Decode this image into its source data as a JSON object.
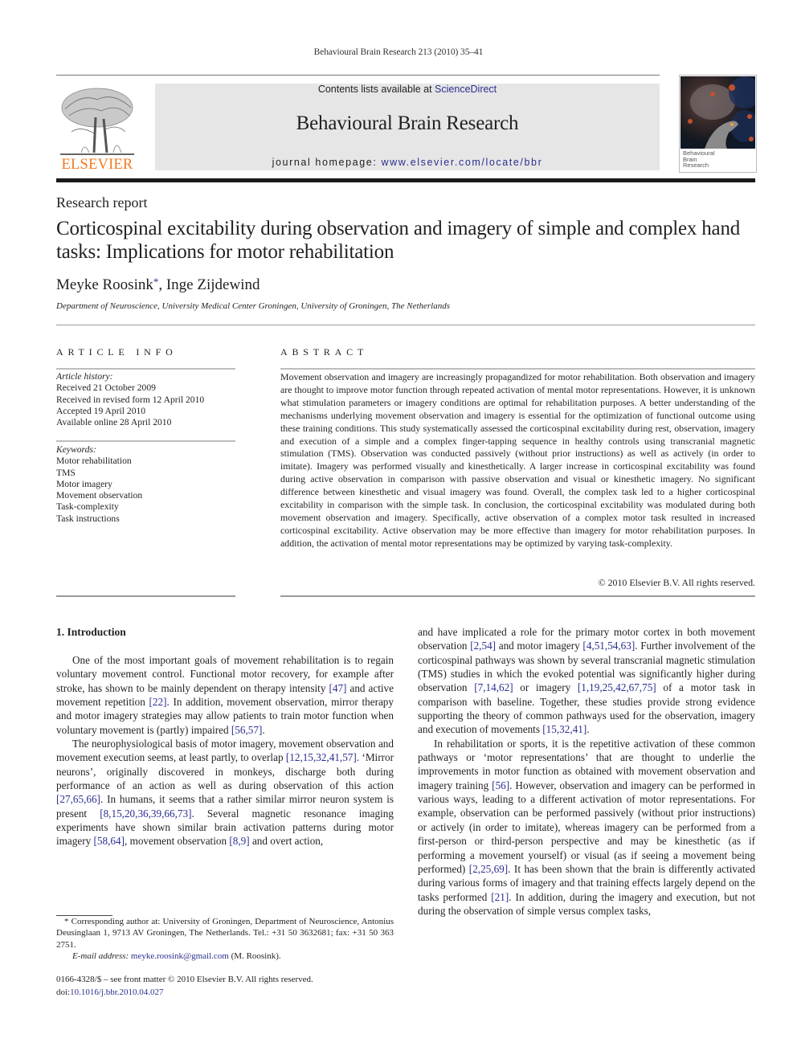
{
  "running_head": "Behavioural Brain Research 213 (2010) 35–41",
  "publisher": {
    "name": "ELSEVIER",
    "brand_color": "#f47920"
  },
  "journal_box": {
    "contents_prefix": "Contents lists available at ",
    "contents_link": "ScienceDirect",
    "journal_title": "Behavioural Brain Research",
    "homepage_prefix": "journal homepage: ",
    "homepage_link": "www.elsevier.com/locate/bbr",
    "link_color": "#2b2f8f"
  },
  "cover": {
    "title_lines": [
      "Behavioural",
      "Brain",
      "Research"
    ]
  },
  "article": {
    "type": "Research report",
    "title": "Corticospinal excitability during observation and imagery of simple and complex hand tasks: Implications for motor rehabilitation",
    "authors": [
      {
        "name": "Meyke Roosink",
        "mark": "*"
      },
      {
        "name": "Inge Zijdewind",
        "mark": ""
      }
    ],
    "author_separator": ", ",
    "affiliation": "Department of Neuroscience, University Medical Center Groningen, University of Groningen, The Netherlands"
  },
  "article_info": {
    "heading": "ARTICLE INFO",
    "history_label": "Article history:",
    "history": [
      "Received 21 October 2009",
      "Received in revised form 12 April 2010",
      "Accepted 19 April 2010",
      "Available online 28 April 2010"
    ],
    "keywords_label": "Keywords:",
    "keywords": [
      "Motor rehabilitation",
      "TMS",
      "Motor imagery",
      "Movement observation",
      "Task-complexity",
      "Task instructions"
    ]
  },
  "abstract": {
    "heading": "ABSTRACT",
    "text": "Movement observation and imagery are increasingly propagandized for motor rehabilitation. Both observation and imagery are thought to improve motor function through repeated activation of mental motor representations. However, it is unknown what stimulation parameters or imagery conditions are optimal for rehabilitation purposes. A better understanding of the mechanisms underlying movement observation and imagery is essential for the optimization of functional outcome using these training conditions. This study systematically assessed the corticospinal excitability during rest, observation, imagery and execution of a simple and a complex finger-tapping sequence in healthy controls using transcranial magnetic stimulation (TMS). Observation was conducted passively (without prior instructions) as well as actively (in order to imitate). Imagery was performed visually and kinesthetically. A larger increase in corticospinal excitability was found during active observation in comparison with passive observation and visual or kinesthetic imagery. No significant difference between kinesthetic and visual imagery was found. Overall, the complex task led to a higher corticospinal excitability in comparison with the simple task. In conclusion, the corticospinal excitability was modulated during both movement observation and imagery. Specifically, active observation of a complex motor task resulted in increased corticospinal excitability. Active observation may be more effective than imagery for motor rehabilitation purposes. In addition, the activation of mental motor representations may be optimized by varying task-complexity.",
    "copyright": "© 2010 Elsevier B.V. All rights reserved."
  },
  "body": {
    "section_heading": "1.  Introduction",
    "left_paragraphs": [
      [
        {
          "t": "One of the most important goals of movement rehabilitation is to regain voluntary movement control. Functional motor recovery, for example after stroke, has shown to be mainly dependent on therapy intensity "
        },
        {
          "ref": "[47]"
        },
        {
          "t": " and active movement repetition "
        },
        {
          "ref": "[22]"
        },
        {
          "t": ". In addition, movement observation, mirror therapy and motor imagery strategies may allow patients to train motor function when voluntary movement is (partly) impaired "
        },
        {
          "ref": "[56,57]"
        },
        {
          "t": "."
        }
      ],
      [
        {
          "t": "The neurophysiological basis of motor imagery, movement observation and movement execution seems, at least partly, to overlap "
        },
        {
          "ref": "[12,15,32,41,57]"
        },
        {
          "t": ". ‘Mirror neurons’, originally discovered in monkeys, discharge both during performance of an action as well as during observation of this action "
        },
        {
          "ref": "[27,65,66]"
        },
        {
          "t": ". In humans, it seems that a rather similar mirror neuron system is present "
        },
        {
          "ref": "[8,15,20,36,39,66,73]"
        },
        {
          "t": ". Several magnetic resonance imaging experiments have shown similar brain activation patterns during motor imagery "
        },
        {
          "ref": "[58,64]"
        },
        {
          "t": ", movement observation "
        },
        {
          "ref": "[8,9]"
        },
        {
          "t": " and overt action,"
        }
      ]
    ],
    "right_paragraphs": [
      [
        {
          "t": "and have implicated a role for the primary motor cortex in both movement observation "
        },
        {
          "ref": "[2,54]"
        },
        {
          "t": " and motor imagery "
        },
        {
          "ref": "[4,51,54,63]"
        },
        {
          "t": ". Further involvement of the corticospinal pathways was shown by several transcranial magnetic stimulation (TMS) studies in which the evoked potential was significantly higher during observation "
        },
        {
          "ref": "[7,14,62]"
        },
        {
          "t": " or imagery "
        },
        {
          "ref": "[1,19,25,42,67,75]"
        },
        {
          "t": " of a motor task in comparison with baseline. Together, these studies provide strong evidence supporting the theory of common pathways used for the observation, imagery and execution of movements "
        },
        {
          "ref": "[15,32,41]"
        },
        {
          "t": "."
        }
      ],
      [
        {
          "t": "In rehabilitation or sports, it is the repetitive activation of these common pathways or ‘motor representations’ that are thought to underlie the improvements in motor function as obtained with movement observation and imagery training "
        },
        {
          "ref": "[56]"
        },
        {
          "t": ". However, observation and imagery can be performed in various ways, leading to a different activation of motor representations. For example, observation can be performed passively (without prior instructions) or actively (in order to imitate), whereas imagery can be performed from a first-person or third-person perspective and may be kinesthetic (as if performing a movement yourself) or visual (as if seeing a movement being performed) "
        },
        {
          "ref": "[2,25,69]"
        },
        {
          "t": ". It has been shown that the brain is differently activated during various forms of imagery and that training effects largely depend on the tasks performed "
        },
        {
          "ref": "[21]"
        },
        {
          "t": ". In addition, during the imagery and execution, but not during the observation of simple versus complex tasks,"
        }
      ]
    ]
  },
  "footnote": {
    "mark": "*",
    "text": "Corresponding author at: University of Groningen, Department of Neuroscience, Antonius Deusinglaan 1, 9713 AV Groningen, The Netherlands. Tel.: +31 50 3632681; fax: +31 50 363 2751.",
    "email_label": "E-mail address:",
    "email": "meyke.roosink@gmail.com",
    "email_suffix": " (M. Roosink)."
  },
  "front_matter": {
    "issn_line": "0166-4328/$ – see front matter © 2010 Elsevier B.V. All rights reserved.",
    "doi_prefix": "doi:",
    "doi": "10.1016/j.bbr.2010.04.027"
  }
}
